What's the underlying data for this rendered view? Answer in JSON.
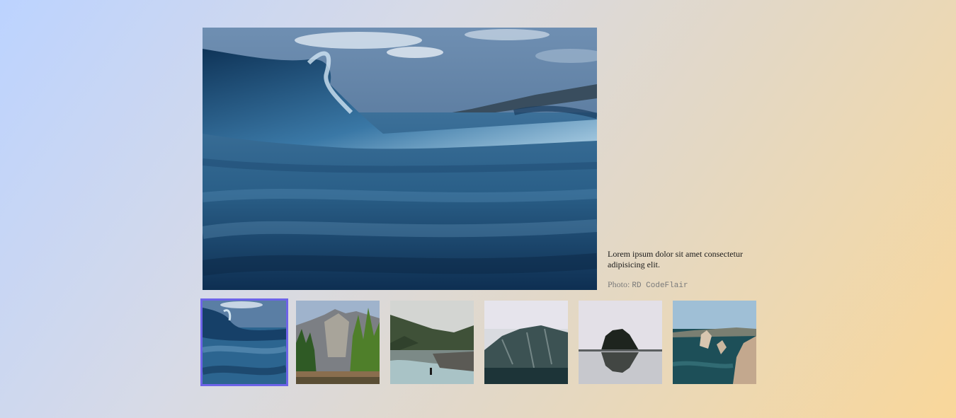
{
  "gallery": {
    "main_image": {
      "icon": "ocean-wave-photo"
    },
    "caption": "Lorem ipsum dolor sit amet consectetur adipisicing elit.",
    "credit_prefix": "Photo:",
    "credit_author": "RD CodeFlair",
    "colors": {
      "active_border": "#6d63e8",
      "background_start": "#bcd3ff",
      "background_end": "#f9d79a"
    },
    "thumbnails": [
      {
        "icon": "ocean-wave-photo",
        "active": true
      },
      {
        "icon": "forest-cliffs-photo",
        "active": false
      },
      {
        "icon": "river-valley-photo",
        "active": false
      },
      {
        "icon": "misty-mountain-photo",
        "active": false
      },
      {
        "icon": "sea-rock-photo",
        "active": false
      },
      {
        "icon": "coastal-cliffs-photo",
        "active": false
      }
    ]
  }
}
